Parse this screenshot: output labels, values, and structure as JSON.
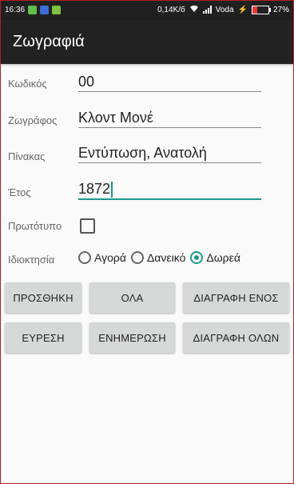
{
  "status_bar": {
    "time": "16:36",
    "speed": "0,14K/б",
    "carrier": "Voda",
    "battery": "27%"
  },
  "app": {
    "title": "Ζωγραφιά"
  },
  "form": {
    "code": {
      "label": "Κωδικός",
      "value": "00"
    },
    "painter": {
      "label": "Ζωγράφος",
      "value": "Κλοντ Μονέ"
    },
    "painting": {
      "label": "Πίνακας",
      "value": "Εντύπωση, Ανατολή"
    },
    "year": {
      "label": "Έτος",
      "value": "1872"
    },
    "original": {
      "label": "Πρωτότυπο",
      "checked": false
    },
    "ownership": {
      "label": "Ιδιοκτησία",
      "options": [
        "Αγορά",
        "Δανεικό",
        "Δωρεά"
      ],
      "selected": "Δωρεά"
    }
  },
  "buttons": {
    "add": "ΠΡΟΣΘΗΚΗ",
    "all": "ΟΛΑ",
    "delete_one": "ΔΙΑΓΡΑΦΗ ΕΝΟΣ",
    "find": "ΕΥΡΕΣΗ",
    "update": "ΕΝΗΜΕΡΩΣΗ",
    "delete_all": "ΔΙΑΓΡΑΦΗ ΟΛΩΝ"
  },
  "colors": {
    "accent": "#1d9a8a",
    "app_bar": "#222222",
    "button": "#d6d7d7"
  }
}
